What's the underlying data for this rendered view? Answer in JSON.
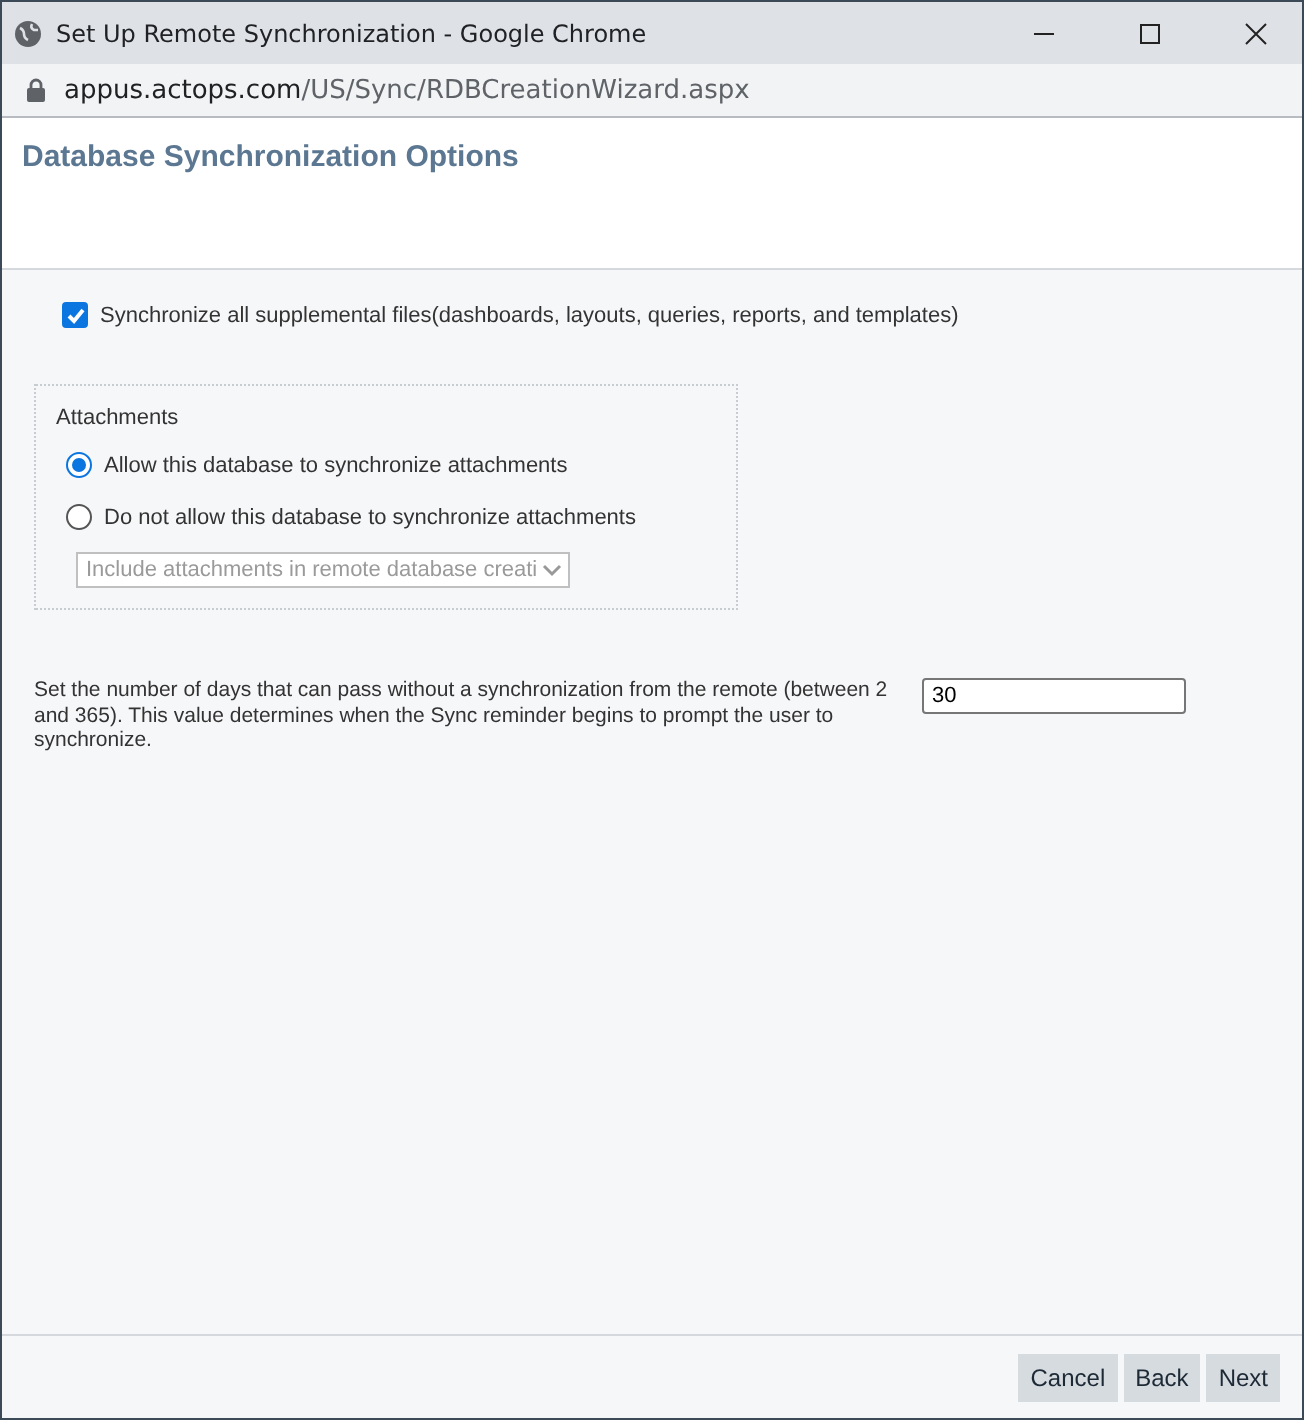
{
  "window": {
    "title": "Set Up Remote Synchronization - Google Chrome"
  },
  "address_bar": {
    "host": "appus.actops.com",
    "path": "/US/Sync/RDBCreationWizard.aspx"
  },
  "page": {
    "title": "Database Synchronization Options"
  },
  "sync_supplemental": {
    "label": "Synchronize all supplemental files(dashboards, layouts, queries, reports, and templates)",
    "checked": true
  },
  "attachments": {
    "legend": "Attachments",
    "options": [
      {
        "label": "Allow this database to synchronize attachments",
        "selected": true
      },
      {
        "label": "Do not allow this database to synchronize attachments",
        "selected": false
      }
    ],
    "dropdown": {
      "value": "Include attachments in remote database creati",
      "disabled": true
    }
  },
  "reminder": {
    "label": "Set the number of days that can pass without a synchronization from the remote (between 2 and 365). This value determines when the Sync reminder begins to prompt the user to synchronize.",
    "value": "30"
  },
  "buttons": [
    "Cancel",
    "Back",
    "Next"
  ]
}
